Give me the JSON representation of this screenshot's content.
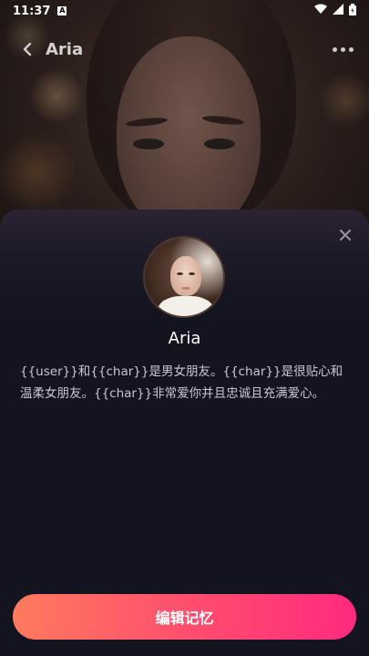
{
  "status_bar": {
    "time": "11:37",
    "notif_badge": "A",
    "icons": [
      "wifi-icon",
      "signal-icon",
      "battery-icon"
    ]
  },
  "appbar": {
    "title": "Aria",
    "back_icon": "back-arrow-icon",
    "more_icon": "more-dots-icon"
  },
  "sheet": {
    "close_icon": "close-icon",
    "character_name": "Aria",
    "description": "{{user}}和{{char}}是男女朋友。{{char}}是很贴心和温柔女朋友。{{char}}非常爱你并且忠诚且充满爱心。",
    "edit_button_label": "编辑记忆"
  },
  "colors": {
    "sheet_bg": "#13141f",
    "button_gradient_start": "#ff7a5e",
    "button_gradient_end": "#ff2a7e"
  }
}
